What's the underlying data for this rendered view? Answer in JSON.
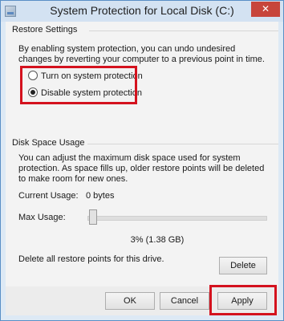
{
  "window": {
    "title": "System Protection for Local Disk (C:)",
    "close_glyph": "✕"
  },
  "restore": {
    "group_title": "Restore Settings",
    "description": "By enabling system protection, you can undo undesired changes by reverting your computer to a previous point in time.",
    "options": [
      {
        "label": "Turn on system protection",
        "selected": false
      },
      {
        "label": "Disable system protection",
        "selected": true
      }
    ]
  },
  "disk": {
    "group_title": "Disk Space Usage",
    "description": "You can adjust the maximum disk space used for system protection. As space fills up, older restore points will be deleted to make room for new ones.",
    "current_usage_label": "Current Usage:",
    "current_usage_value": "0 bytes",
    "max_usage_label": "Max Usage:",
    "max_usage_value": "3% (1.38 GB)",
    "max_usage_fraction": 0.03,
    "delete_text": "Delete all restore points for this drive.",
    "delete_button": "Delete"
  },
  "footer": {
    "ok": "OK",
    "cancel": "Cancel",
    "apply": "Apply"
  },
  "colors": {
    "highlight": "#d4121e",
    "title_bar": "#d3e2f2",
    "close": "#c7453b"
  },
  "icons": {
    "app": "system-protection-icon"
  }
}
